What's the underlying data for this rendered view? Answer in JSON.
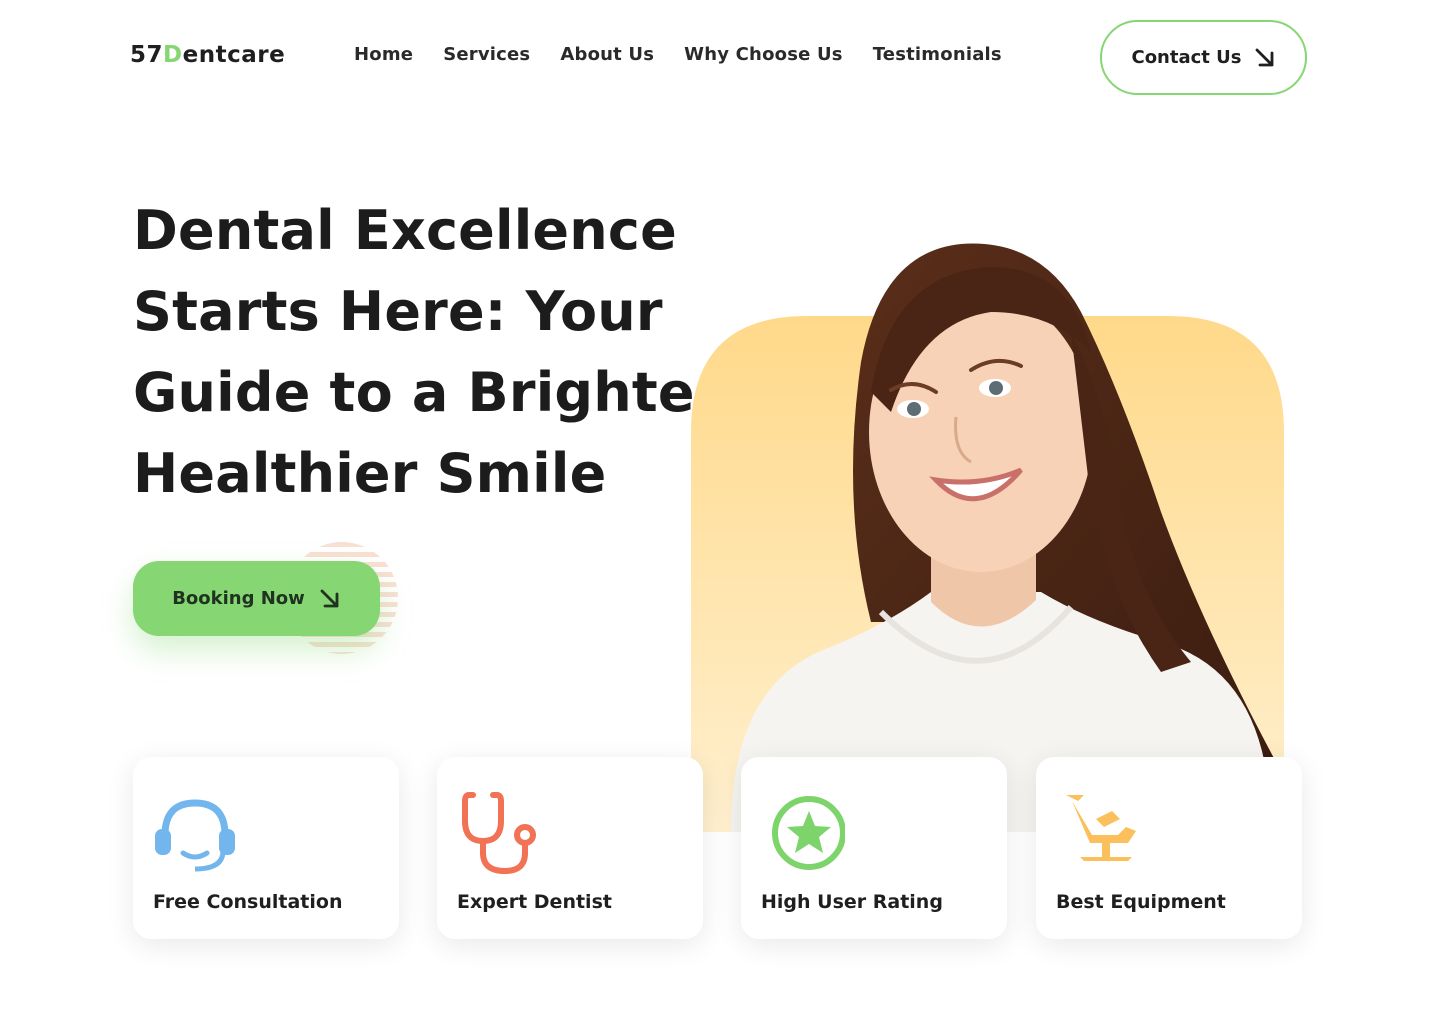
{
  "brand": {
    "prefix": "57",
    "accent_letter": "D",
    "suffix": "entcare",
    "accent_color": "#86d673"
  },
  "nav": {
    "items": [
      {
        "label": "Home"
      },
      {
        "label": "Services"
      },
      {
        "label": "About Us"
      },
      {
        "label": "Why Choose Us"
      },
      {
        "label": "Testimonials"
      }
    ],
    "contact_label": "Contact Us",
    "contact_icon": "arrow-down-right-icon"
  },
  "hero": {
    "title": "Dental Excellence Starts Here: Your Guide to a Brighter, Healthier Smile",
    "cta_label": "Booking Now",
    "cta_icon": "arrow-down-right-icon",
    "image_bg_color": "#ffd98a"
  },
  "features": [
    {
      "label": "Free Consultation",
      "icon": "headset-icon",
      "color": "#73b6ee"
    },
    {
      "label": "Expert Dentist",
      "icon": "stethoscope-icon",
      "color": "#f27255"
    },
    {
      "label": "High User Rating",
      "icon": "star-badge-icon",
      "color": "#7cd46a"
    },
    {
      "label": "Best Equipment",
      "icon": "dental-chair-icon",
      "color": "#fbbf5c"
    }
  ],
  "colors": {
    "primary_green": "#86d673",
    "text_dark": "#1f1f1f"
  }
}
